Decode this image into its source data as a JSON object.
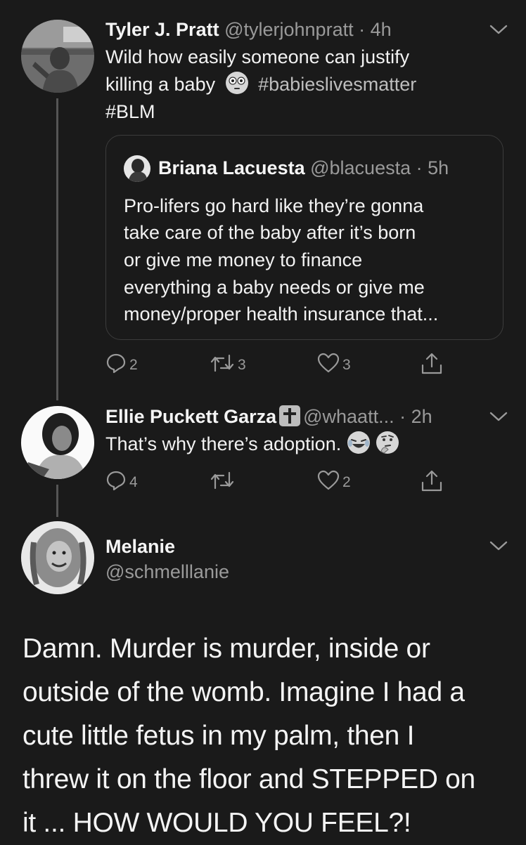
{
  "tweet1": {
    "name": "Tyler J. Pratt",
    "handle": "@tylerjohnpratt",
    "time": "· 4h",
    "text_line1": "Wild how easily someone can justify",
    "text_line2a": "killing a baby",
    "text_line2_emoji": "flushed-face-emoji",
    "text_line2b": "#babieslivesmatter",
    "text_line3": "#BLM",
    "quote": {
      "name": "Briana Lacuesta",
      "handle": "@blacuesta",
      "time": "· 5h",
      "lines": [
        "Pro-lifers go hard like they’re gonna",
        "take care of the baby after it’s born",
        "or give me money to finance",
        "everything a baby needs or give me",
        "money/proper health insurance that..."
      ]
    },
    "replies": "2",
    "retweets": "3",
    "likes": "3"
  },
  "tweet2": {
    "name": "Ellie Puckett Garza",
    "badge_icon": "latin-cross-emoji",
    "handle": "@whaatt...",
    "time": "· 2h",
    "text": "That’s why there’s adoption.",
    "emojis": [
      "laughing-tears-emoji",
      "thinking-face-emoji"
    ],
    "replies": "4",
    "retweets": "",
    "likes": "2"
  },
  "tweet3": {
    "name": "Melanie",
    "handle": "@schmelllanie",
    "body_lines": [
      "Damn. Murder is murder, inside or",
      "outside of the womb. Imagine I had a",
      "cute little fetus in my palm, then I",
      "threw it on the floor and STEPPED on",
      "it ... HOW WOULD YOU FEEL?!"
    ]
  },
  "colors": {
    "background": "#1a1a1a",
    "text": "#f2f2f2",
    "secondary": "#9a9a9a",
    "border": "#3c3c3c"
  }
}
